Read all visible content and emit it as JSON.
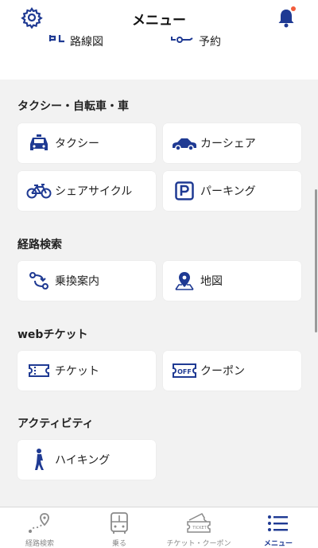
{
  "header": {
    "title": "メニュー"
  },
  "top_strip": {
    "left_label": "路線図",
    "right_label": "予約"
  },
  "sections": [
    {
      "title": "タクシー・自転車・車",
      "items": [
        "タクシー",
        "カーシェア",
        "シェアサイクル",
        "パーキング"
      ]
    },
    {
      "title": "経路検索",
      "items": [
        "乗換案内",
        "地図"
      ]
    },
    {
      "title": "webチケット",
      "items": [
        "チケット",
        "クーポン"
      ]
    },
    {
      "title": "アクティビティ",
      "items": [
        "ハイキング"
      ]
    }
  ],
  "tabs": [
    {
      "label": "経路検索",
      "icon": "route-search-icon"
    },
    {
      "label": "乗る",
      "icon": "bus-icon"
    },
    {
      "label": "チケット・クーポン",
      "icon": "ticket-icon"
    },
    {
      "label": "メニュー",
      "icon": "menu-list-icon",
      "active": true
    }
  ],
  "colors": {
    "brand": "#1f3a93",
    "notification": "#f25c3b",
    "background": "#f2f2f2"
  }
}
